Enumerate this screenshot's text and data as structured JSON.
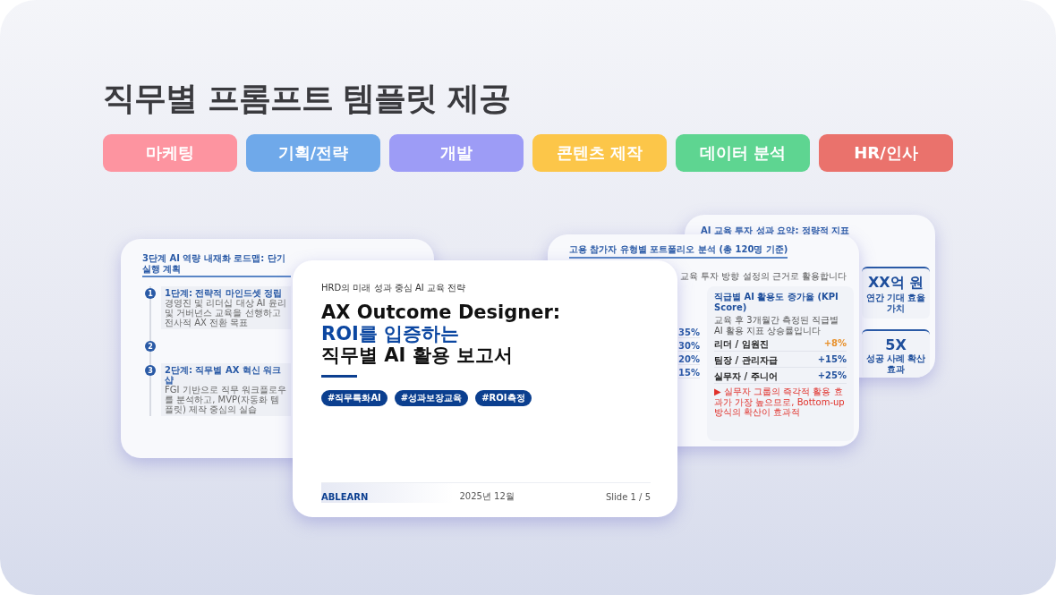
{
  "heading": "직무별 프롬프트 템플릿 제공",
  "categories": [
    {
      "label": "마케팅",
      "color": "#fd94a0"
    },
    {
      "label": "기획/전략",
      "color": "#6fa9ea"
    },
    {
      "label": "개발",
      "color": "#9d9cf6"
    },
    {
      "label": "콘텐츠 제작",
      "color": "#fcc649"
    },
    {
      "label": "데이터 분석",
      "color": "#5ed591"
    },
    {
      "label": "HR/인사",
      "color": "#ea726c"
    }
  ],
  "slides": [
    {
      "kind": "roadmap",
      "title": "3단계 AI 역량 내재화 로드맵: 단기 실행 계획",
      "steps": [
        {
          "number": "1",
          "title": "1단계: 전략적 마인드셋 정립",
          "description": "경영진 및 리더십 대상 AI 윤리 및 거버넌스 교육을 선행하고 전사적 AX 전환 목표"
        },
        {
          "number": "2"
        },
        {
          "number": "3",
          "title": "2단계: 직무별 AX 혁신 워크샵",
          "description": "FGI 기반으로 직무 워크플로우를 분석하고, MVP(자동화 템플릿) 제작 중심의 실습"
        }
      ]
    },
    {
      "kind": "summary",
      "title": "AI 교육 투자 성과 요약: 정량적 지표",
      "metrics": [
        {
          "value": "XX억 원",
          "label": "연간 기대 효율 가치"
        },
        {
          "value": "5X",
          "label": "성공 사례 확산 효과"
        }
      ]
    },
    {
      "kind": "portfolio",
      "title": "고용 참가자 유형별 포트폴리오 분석 (총 120명 기준)",
      "subtitle": "교육 투자 방향 설정의 근거로 활용합니다",
      "shares": [
        "35%",
        "30%",
        "20%",
        "15%"
      ],
      "kpi": {
        "title": "직급별 AI 활용도 증가율 (KPI Score)",
        "description": "교육 후 3개월간 측정된 직급별 AI 활용 지표 상승률입니다",
        "rows": [
          {
            "label": "리더 / 임원진",
            "value": "+8%",
            "color": "#e8902a"
          },
          {
            "label": "팀장 / 관리자급",
            "value": "+15%",
            "color": "#1f4f9c"
          },
          {
            "label": "실무자 / 주니어",
            "value": "+25%",
            "color": "#1f4f9c"
          }
        ],
        "note": "▶ 실무자 그룹의 즉각적 활용 효과가 가장 높으므로, Bottom-up 방식의 확산이 효과적"
      }
    },
    {
      "kind": "cover",
      "subtitle": "HRD의 미래 성과 중심 AI 교육 전략",
      "title_lines": [
        {
          "text": "AX Outcome Designer:",
          "highlight": false
        },
        {
          "text": "ROI를 입증하는",
          "highlight": true
        },
        {
          "text": "직무별 AI 활용 보고서",
          "highlight": false
        }
      ],
      "tags": [
        "#직무특화AI",
        "#성과보장교육",
        "#ROI측정"
      ],
      "footer": {
        "brand": "ABLEARN",
        "date": "2025년 12월",
        "page": "Slide 1 / 5"
      }
    }
  ]
}
